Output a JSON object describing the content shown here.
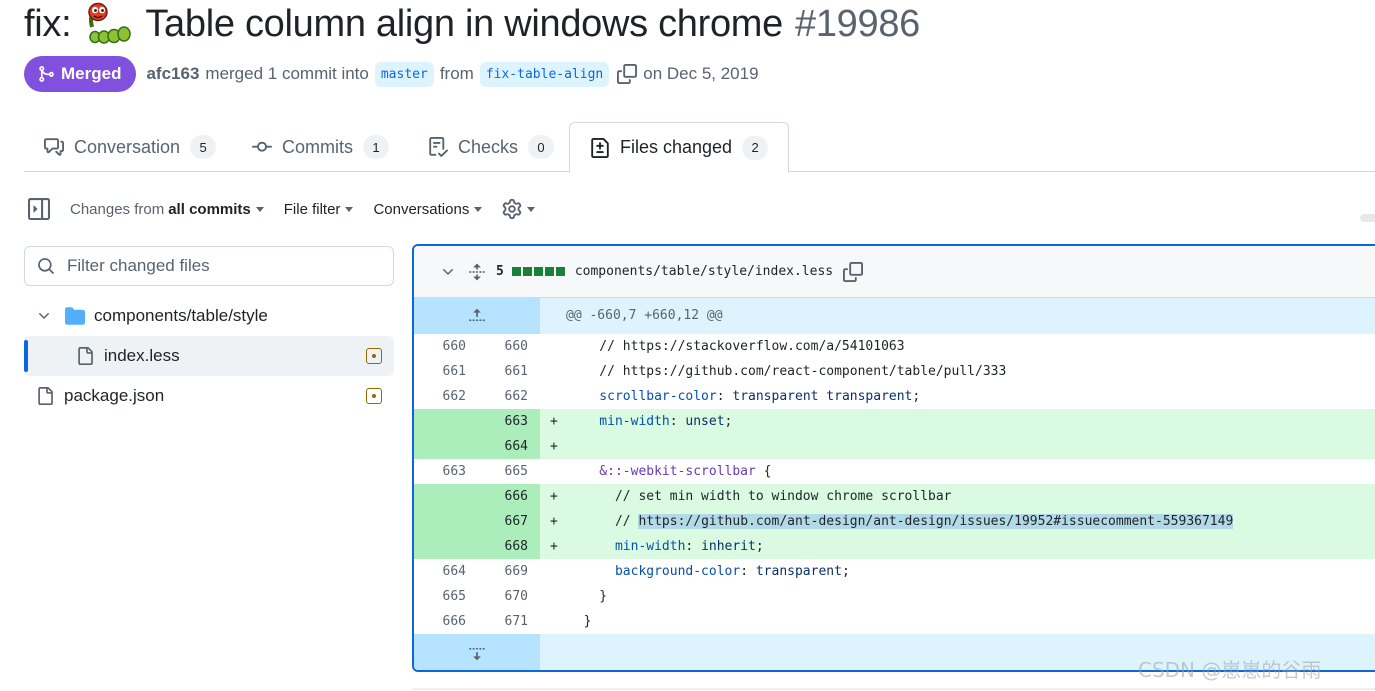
{
  "pr": {
    "title_prefix": "fix:",
    "title": "Table column align in windows chrome",
    "number": "#19986",
    "state": "Merged",
    "author": "afc163",
    "action": "merged 1 commit into",
    "base_branch": "master",
    "from_word": "from",
    "head_branch": "fix-table-align",
    "date": "on Dec 5, 2019"
  },
  "tabs": [
    {
      "label": "Conversation",
      "count": "5",
      "icon": "comment-discussion-icon"
    },
    {
      "label": "Commits",
      "count": "1",
      "icon": "git-commit-icon"
    },
    {
      "label": "Checks",
      "count": "0",
      "icon": "checklist-icon"
    },
    {
      "label": "Files changed",
      "count": "2",
      "icon": "file-diff-icon",
      "active": true
    }
  ],
  "toolbar": {
    "changes_prefix": "Changes from",
    "changes_value": "all commits",
    "file_filter": "File filter",
    "conversations": "Conversations"
  },
  "file_tree": {
    "filter_placeholder": "Filter changed files",
    "folder": "components/table/style",
    "files": [
      {
        "name": "index.less",
        "selected": true,
        "status": "modified"
      },
      {
        "name": "package.json",
        "selected": false,
        "status": "modified"
      }
    ]
  },
  "diff": {
    "stat": "5",
    "file_path": "components/table/style/index.less",
    "hunk_header": "@@ -660,7 +660,12 @@",
    "lines": [
      {
        "old": "660",
        "new": "660",
        "sign": "",
        "code": "    // https://stackoverflow.com/a/54101063"
      },
      {
        "old": "661",
        "new": "661",
        "sign": "",
        "code": "    // https://github.com/react-component/table/pull/333"
      },
      {
        "old": "662",
        "new": "662",
        "sign": "",
        "code": "    scrollbar-color: transparent transparent;"
      },
      {
        "old": "",
        "new": "663",
        "sign": "+",
        "code": "    min-width: unset;"
      },
      {
        "old": "",
        "new": "664",
        "sign": "+",
        "code": ""
      },
      {
        "old": "663",
        "new": "665",
        "sign": "",
        "code": "    &::-webkit-scrollbar {"
      },
      {
        "old": "",
        "new": "666",
        "sign": "+",
        "code": "      // set min width to window chrome scrollbar"
      },
      {
        "old": "",
        "new": "667",
        "sign": "+",
        "code": "      // https://github.com/ant-design/ant-design/issues/19952#issuecomment-559367149"
      },
      {
        "old": "",
        "new": "668",
        "sign": "+",
        "code": "      min-width: inherit;"
      },
      {
        "old": "664",
        "new": "669",
        "sign": "",
        "code": "      background-color: transparent;"
      },
      {
        "old": "665",
        "new": "670",
        "sign": "",
        "code": "    }"
      },
      {
        "old": "666",
        "new": "671",
        "sign": "",
        "code": "  }"
      }
    ]
  },
  "watermark": "CSDN @崽崽的谷雨",
  "colors": {
    "merged": "#8250df",
    "link": "#0969da",
    "add_bg": "#dafbe1",
    "add_num_bg": "#aceebb",
    "hunk_bg": "#ddf4ff"
  }
}
